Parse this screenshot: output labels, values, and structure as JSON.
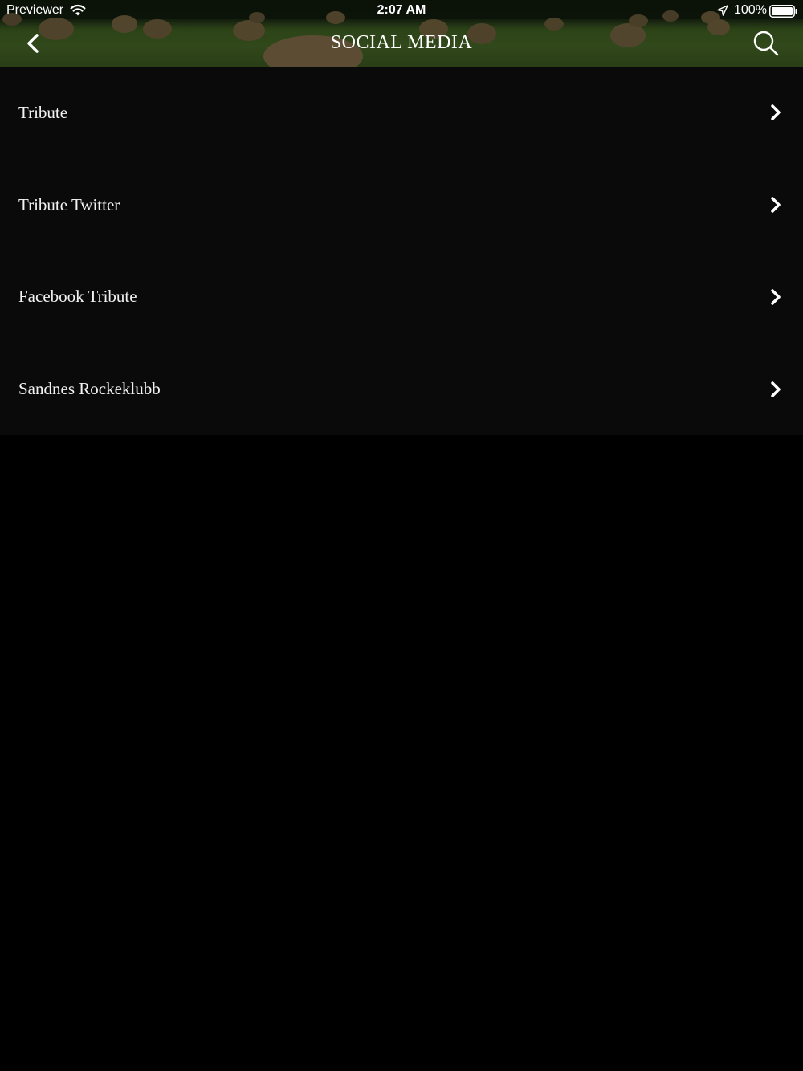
{
  "status_bar": {
    "carrier": "Previewer",
    "time": "2:07 AM",
    "battery": "100%",
    "icons": [
      "wifi-icon",
      "location-arrow-icon",
      "battery-icon"
    ]
  },
  "nav": {
    "title": "SOCIAL MEDIA",
    "back_icon": "chevron-left-icon",
    "search_icon": "search-icon"
  },
  "list": {
    "items": [
      {
        "label": "Tribute",
        "icon": "chevron-right-icon"
      },
      {
        "label": "Tribute Twitter",
        "icon": "chevron-right-icon"
      },
      {
        "label": "Facebook Tribute",
        "icon": "chevron-right-icon"
      },
      {
        "label": "Sandnes Rockeklubb",
        "icon": "chevron-right-icon"
      }
    ]
  },
  "colors": {
    "background": "#000000",
    "list_background": "#0a0a0a",
    "text": "#f2f2f2",
    "header_grass": "#5d8a33"
  }
}
